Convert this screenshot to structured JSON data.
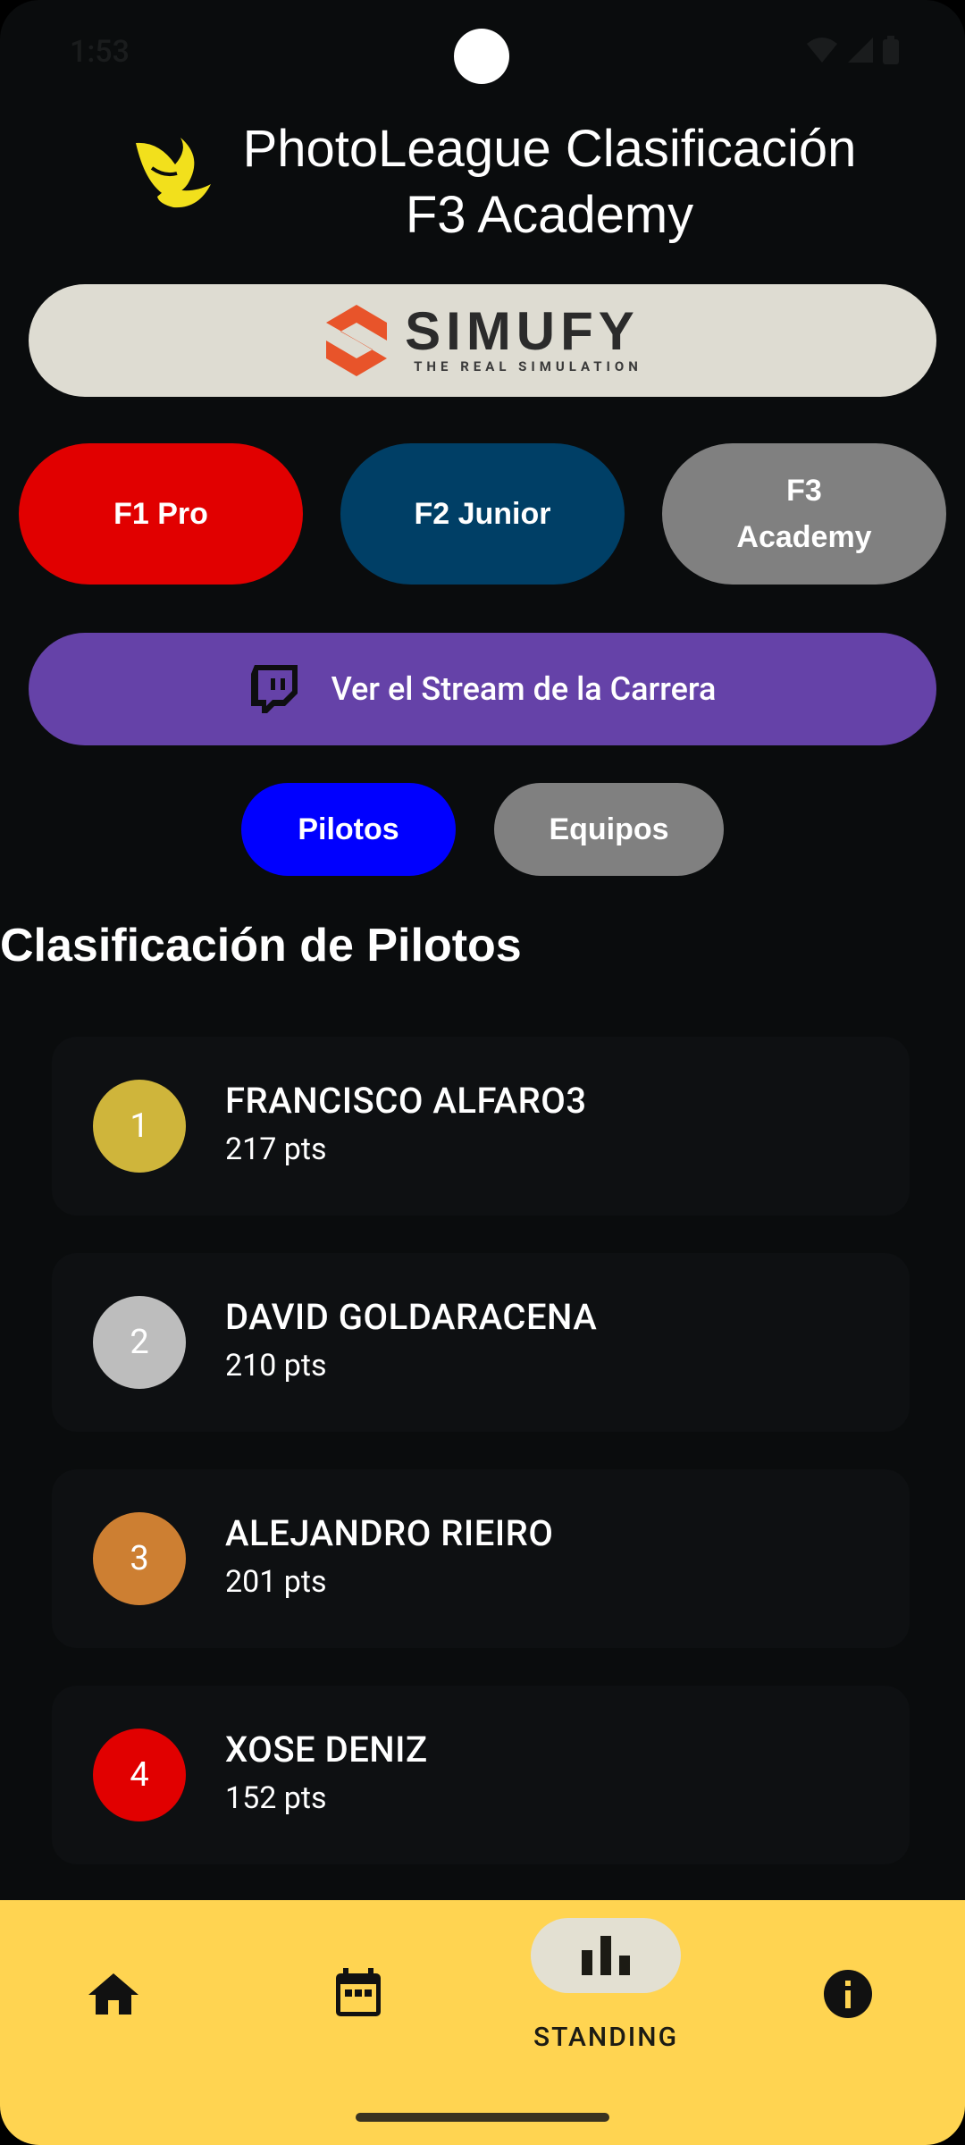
{
  "status_bar": {
    "time": "1:53"
  },
  "header": {
    "logo_icon": "yellow-swoosh-logo",
    "title_line1": "PhotoLeague Clasificación",
    "title_line2": "F3 Academy"
  },
  "sponsor": {
    "name": "SIMUFY",
    "tagline": "THE REAL SIMULATION",
    "colors": {
      "background": "#dedcd2",
      "mark": "#e8542a"
    }
  },
  "leagues": [
    {
      "label": "F1 Pro",
      "color": "#e10000"
    },
    {
      "label": "F2 Junior",
      "color": "#003f66"
    },
    {
      "label": "F3 Academy",
      "color": "#808080"
    }
  ],
  "stream": {
    "label": "Ver el Stream de la Carrera",
    "icon": "twitch-icon",
    "color": "#6542a8"
  },
  "toggle": {
    "pilotos": "Pilotos",
    "equipos": "Equipos",
    "active": "Pilotos"
  },
  "section_title": "Clasificación de Pilotos",
  "standings": [
    {
      "position": "1",
      "name": "FRANCISCO ALFARO3",
      "points": "217 pts",
      "badge_color": "#cfb53b"
    },
    {
      "position": "2",
      "name": "DAVID GOLDARACENA",
      "points": "210 pts",
      "badge_color": "#bdbdbd"
    },
    {
      "position": "3",
      "name": "ALEJANDRO RIEIRO",
      "points": "201 pts",
      "badge_color": "#cd7f32"
    },
    {
      "position": "4",
      "name": "XOSE DENIZ",
      "points": "152 pts",
      "badge_color": "#e10000"
    }
  ],
  "bottom_nav": {
    "items": [
      {
        "icon": "home-icon"
      },
      {
        "icon": "calendar-icon"
      },
      {
        "icon": "bar-chart-icon",
        "label": "STANDING",
        "active": true
      },
      {
        "icon": "info-icon"
      }
    ],
    "background": "#ffd451"
  }
}
